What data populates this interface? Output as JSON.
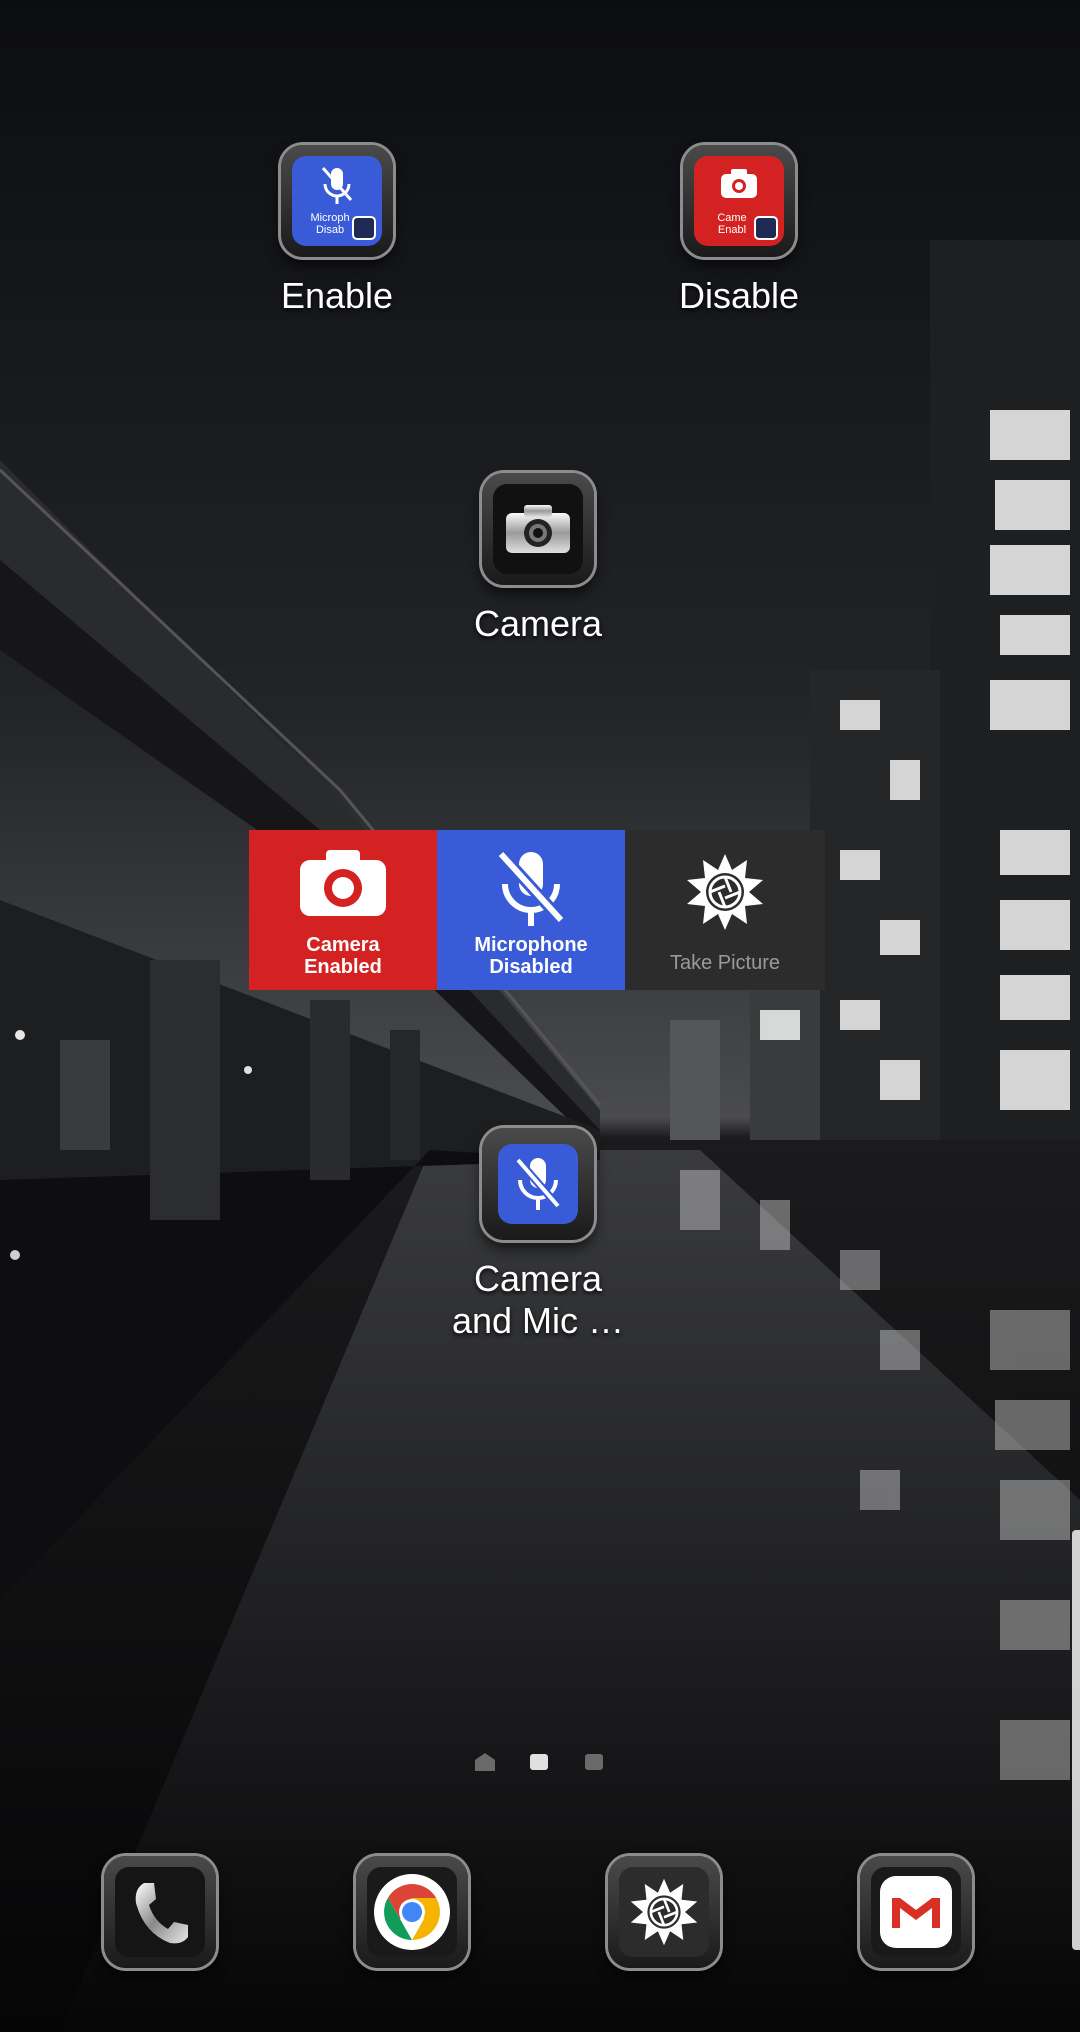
{
  "home": {
    "shortcuts": [
      {
        "label": "Enable",
        "mini_text_1": "Microph",
        "mini_text_2": "Disab"
      },
      {
        "label": "Disable",
        "mini_text_1": "Came",
        "mini_text_2": "Enabl"
      },
      {
        "label": "Camera"
      },
      {
        "label": "Camera\nand Mic …"
      }
    ],
    "widget": {
      "camera_tile": "Camera\nEnabled",
      "mic_tile": "Microphone\nDisabled",
      "take_picture": "Take Picture"
    },
    "pages": {
      "count": 3,
      "current": 2
    }
  },
  "dock": [
    {
      "icon": "phone-icon"
    },
    {
      "icon": "chrome-icon"
    },
    {
      "icon": "shutter-icon"
    },
    {
      "icon": "gmail-icon"
    }
  ],
  "colors": {
    "camera_red": "#d42121",
    "mic_blue": "#3a5bd8",
    "tile_dark": "#2c2c2c"
  }
}
